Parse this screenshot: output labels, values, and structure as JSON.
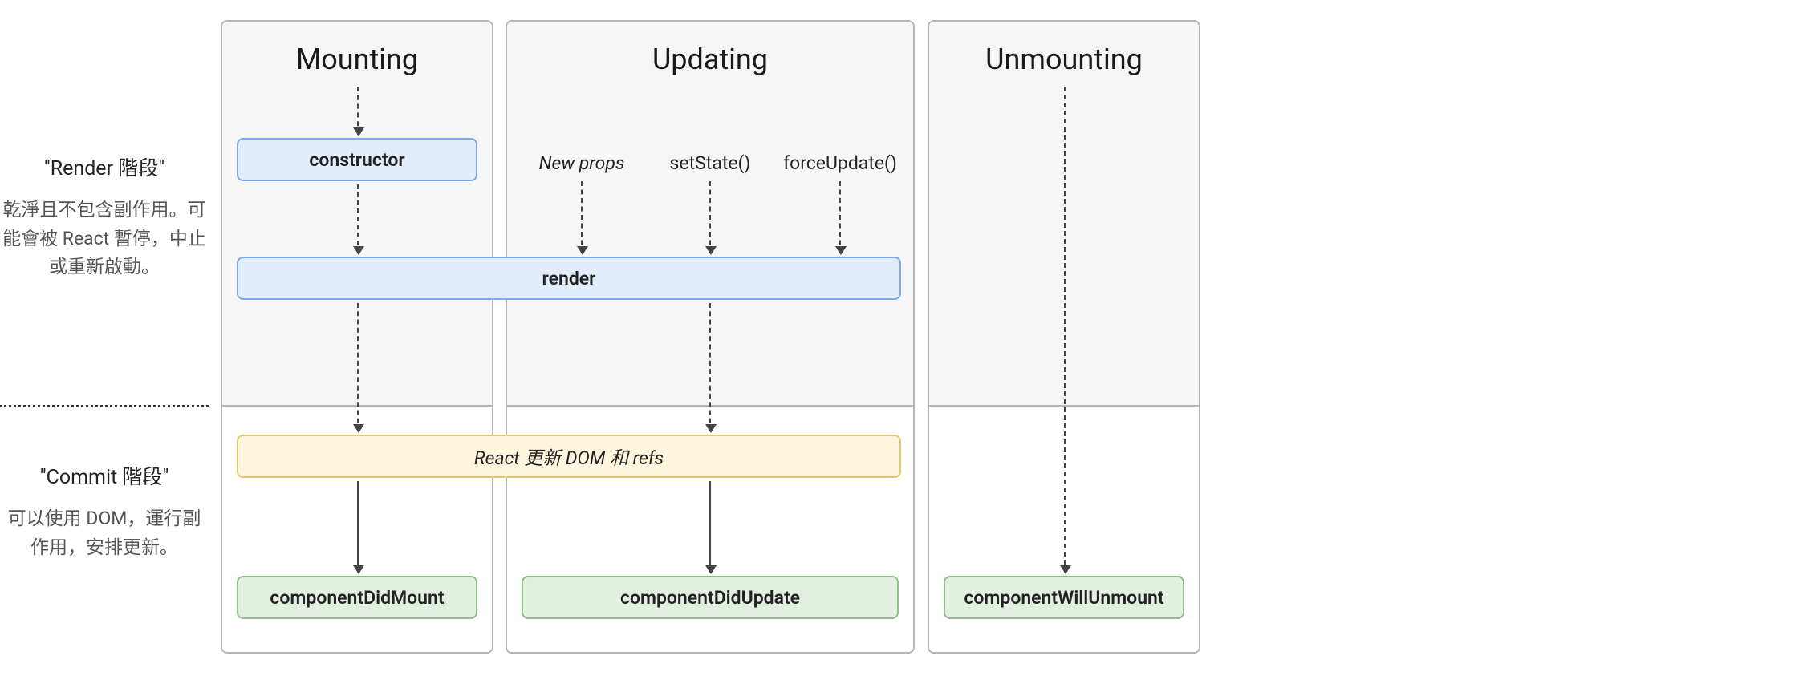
{
  "phases": {
    "render": {
      "title": "\"Render 階段\"",
      "desc": "乾淨且不包含副作用。可能會被 React 暫停，中止或重新啟動。"
    },
    "commit": {
      "title": "\"Commit 階段\"",
      "desc": "可以使用 DOM，運行副作用，安排更新。"
    }
  },
  "columns": {
    "mounting": "Mounting",
    "updating": "Updating",
    "unmounting": "Unmounting"
  },
  "triggers": {
    "newProps": "New props",
    "setState": "setState()",
    "forceUpdate": "forceUpdate()"
  },
  "nodes": {
    "constructor": "constructor",
    "render": "render",
    "reactUpdates": "React 更新 DOM 和 refs",
    "didMount": "componentDidMount",
    "didUpdate": "componentDidUpdate",
    "willUnmount": "componentWillUnmount"
  }
}
